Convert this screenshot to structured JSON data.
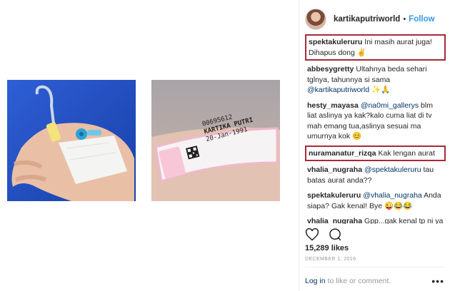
{
  "post": {
    "username": "kartikaputriworld",
    "dot": "•",
    "follow_label": "Follow",
    "likes": "15,289 likes",
    "date": "DECEMBER 1, 2016",
    "login_link": "Log in",
    "login_text": "to like or comment.",
    "more_label": "•••"
  },
  "band_label": {
    "id": "00695612",
    "name": "KARTIKA PUTRI",
    "dob": "20-Jan-1991"
  },
  "comments": [
    {
      "user": "spektakuleruru",
      "text": "Ini masih aurat juga! Dihapus dong ✌",
      "highlight": true
    },
    {
      "user": "abbesygretty",
      "text": "Ultahnya beda sehari tglnya, tahunnya si sama",
      "mention": "@kartikaputriworld",
      "tail": "✨🙏",
      "highlight": false
    },
    {
      "user": "hesty_mayasa",
      "mention": "@na0mi_gallerys",
      "text": "blm liat aslinya ya kak?kalo cuma liat di tv mah emang tua,aslinya sesuai ma umurnya kok 😊",
      "highlight": false
    },
    {
      "user": "nuramanatur_rizqa",
      "text": "Kak lengan aurat",
      "highlight": true
    },
    {
      "user": "vhalia_nugraha",
      "mention": "@spektakuleruru",
      "text": "tau batas aurat anda??",
      "highlight": false
    },
    {
      "user": "spektakuleruru",
      "mention": "@vhalia_nugraha",
      "text": "Anda siapa? Gak kenal! Bye 😜😂😂",
      "highlight": false
    },
    {
      "user": "vhalia_nugraha",
      "text": "Gpp...gak kenal tp ni ya nak...gw kasi tau klo batas aurat wanita itu muka dan kedua telapak tangan...jd laen kali ga asal ngomong di lapak orang...biar pinter ga nyinyirin org yang",
      "highlight": false
    }
  ]
}
